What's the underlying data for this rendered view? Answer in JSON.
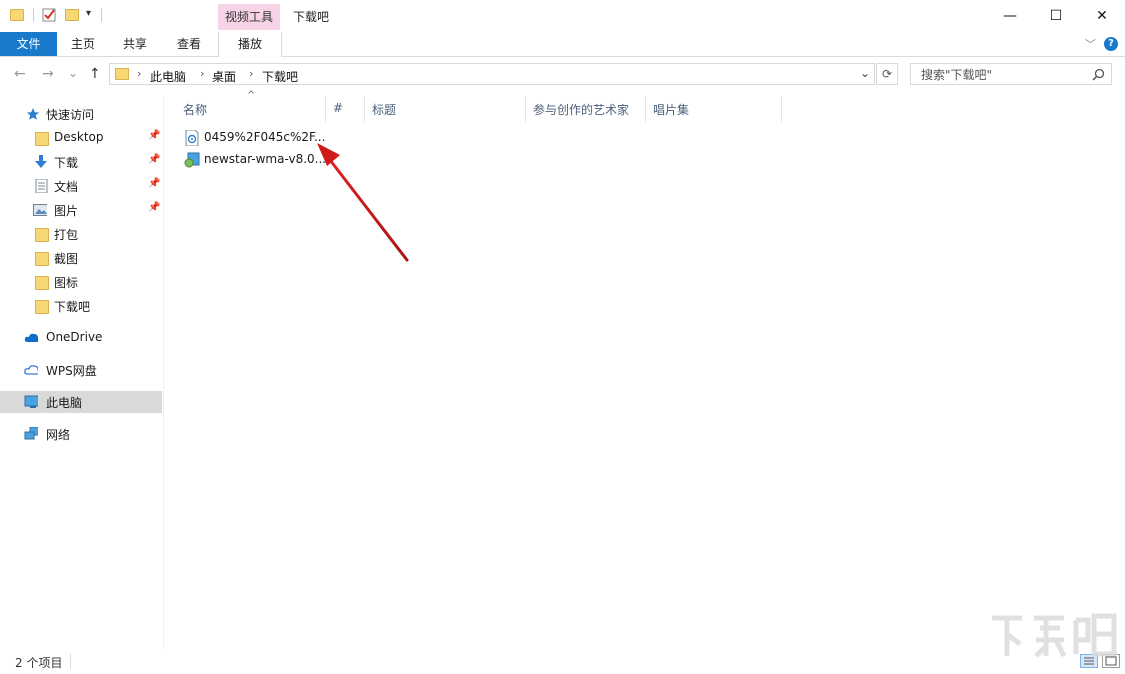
{
  "titlebar": {
    "context_tab": "视频工具",
    "window_title": "下载吧",
    "minimize_glyph": "—",
    "maximize_glyph": "☐",
    "close_glyph": "✕"
  },
  "ribbon": {
    "tabs": [
      {
        "label": "文件"
      },
      {
        "label": "主页"
      },
      {
        "label": "共享"
      },
      {
        "label": "查看"
      },
      {
        "label": "播放"
      }
    ],
    "expand_glyph": "﹀",
    "help_glyph": "?"
  },
  "nav": {
    "back_glyph": "←",
    "forward_glyph": "→",
    "recent_glyph": "⌄",
    "up_glyph": "↑",
    "breadcrumb": [
      "此电脑",
      "桌面",
      "下载吧"
    ],
    "separator": "›",
    "dropdown_glyph": "⌄",
    "refresh_glyph": "⟳",
    "search_placeholder": "搜索\"下载吧\""
  },
  "sidebar": {
    "quick_access": "快速访问",
    "items": [
      {
        "label": "Desktop",
        "pinned": true,
        "icon": "folder-icon"
      },
      {
        "label": "下载",
        "pinned": true,
        "icon": "download-icon"
      },
      {
        "label": "文档",
        "pinned": true,
        "icon": "document-icon"
      },
      {
        "label": "图片",
        "pinned": true,
        "icon": "picture-icon"
      },
      {
        "label": "打包",
        "pinned": false,
        "icon": "folder-icon"
      },
      {
        "label": "截图",
        "pinned": false,
        "icon": "folder-icon"
      },
      {
        "label": "图标",
        "pinned": false,
        "icon": "folder-icon"
      },
      {
        "label": "下载吧",
        "pinned": false,
        "icon": "folder-icon"
      }
    ],
    "onedrive": "OneDrive",
    "wps": "WPS网盘",
    "this_pc": "此电脑",
    "network": "网络"
  },
  "columns": {
    "name": "名称",
    "number": "#",
    "title": "标题",
    "artist": "参与创作的艺术家",
    "album": "唱片集",
    "sort_glyph": "^"
  },
  "files": [
    {
      "name": "0459%2F045c%2F...",
      "icon": "media-file-icon"
    },
    {
      "name": "newstar-wma-v8.0...",
      "icon": "installer-icon"
    }
  ],
  "status": {
    "count": "2 个项目"
  },
  "colors": {
    "file_tab_bg": "#1979ca",
    "context_tab_bg": "#f6d3e6",
    "selected_bg": "#d9d9d9",
    "arrow": "#d01919"
  }
}
